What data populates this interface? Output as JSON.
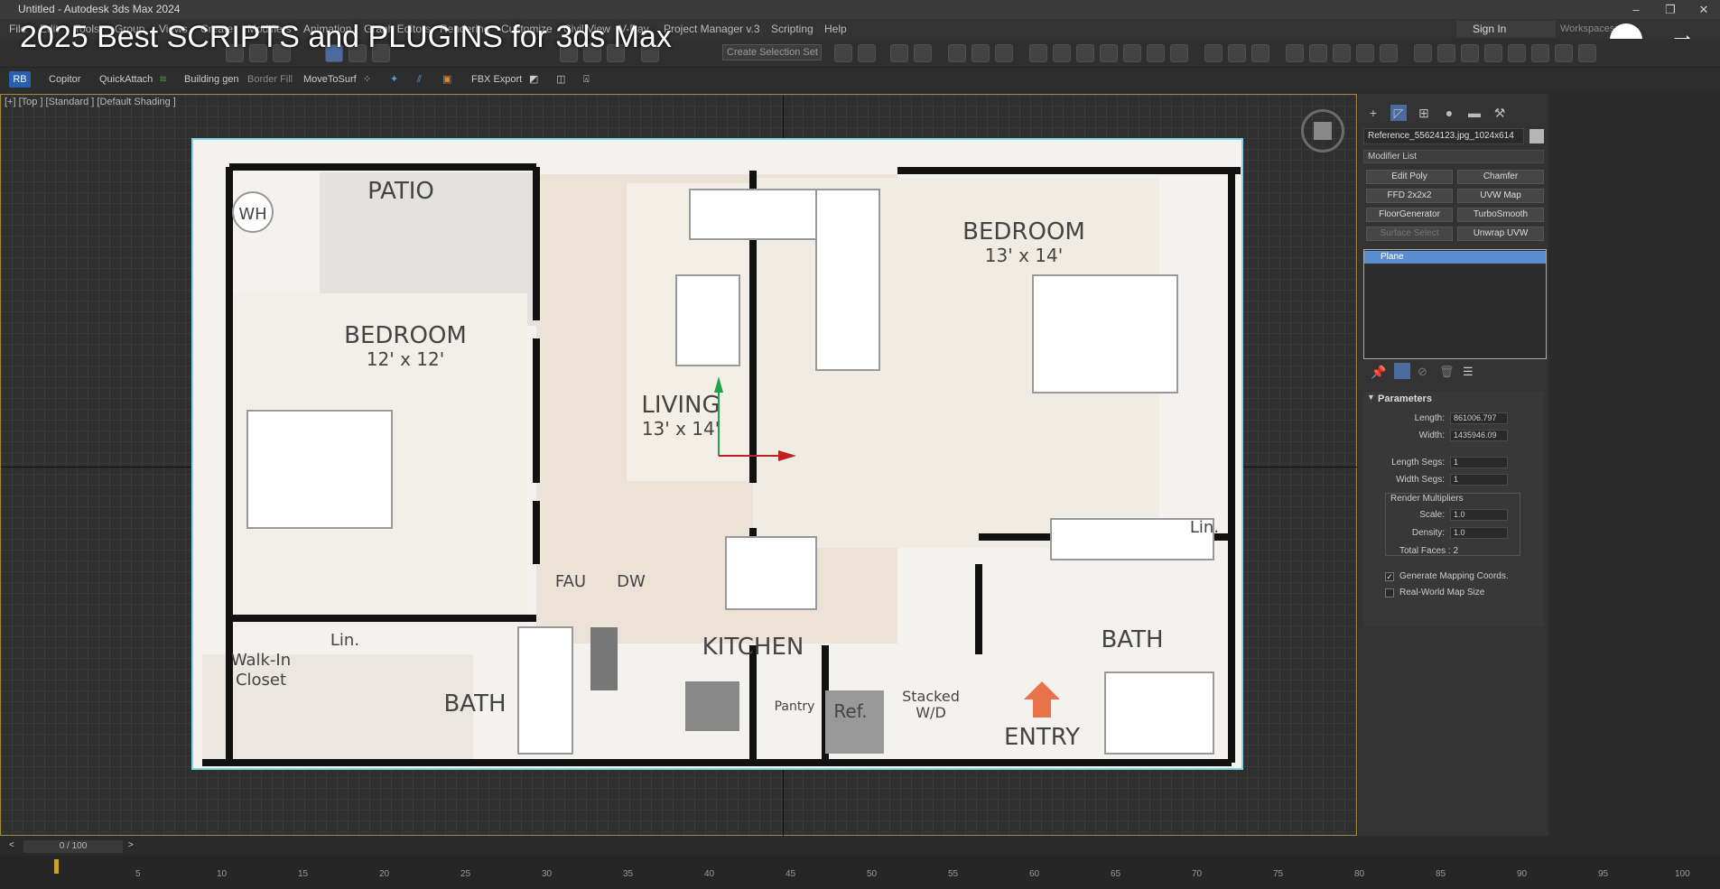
{
  "window": {
    "title": "Untitled - Autodesk 3ds Max 2024"
  },
  "overlay": {
    "title": "2025 Best SCRIPTS and PLUGINS for 3ds Max"
  },
  "menubar": {
    "items": [
      "File",
      "Edit",
      "Tools",
      "Group",
      "Views",
      "Create",
      "Modifiers",
      "Animation",
      "Graph Editors",
      "Rendering",
      "Customize",
      "Civil View",
      "V-Ray",
      "Project Manager v.3",
      "Scripting",
      "Help"
    ],
    "sign_in": "Sign In",
    "workspace": "Workspaces:"
  },
  "toolbar": {
    "selection_set_placeholder": "Create Selection Set"
  },
  "ribbon": {
    "logo": "RB",
    "items": [
      "Copitor",
      "QuickAttach",
      "Building gen",
      "Border Fill",
      "MoveToSurf",
      "FBX Export"
    ]
  },
  "viewport": {
    "label": "[+] [Top ] [Standard ] [Default Shading ]"
  },
  "floorplan": {
    "rooms": [
      "PATIO",
      "WH",
      "BEDROOM",
      "12' x 12'",
      "LIVING",
      "13' x 14'",
      "BEDROOM",
      "13' x 14'",
      "Lin.",
      "FAU",
      "DW",
      "KITCHEN",
      "Lin.",
      "Walk-In",
      "Closet",
      "BATH",
      "Pantry",
      "Ref.",
      "Stacked",
      "W/D",
      "ENTRY",
      "BATH"
    ]
  },
  "command_panel": {
    "object_name": "Reference_55624123.jpg_1024x614",
    "modifier_list": "Modifier List",
    "modifier_buttons": [
      "Edit Poly",
      "Chamfer",
      "FFD 2x2x2",
      "UVW Map",
      "FloorGenerator",
      "TurboSmooth",
      "Surface Select",
      "Unwrap UVW"
    ],
    "stack_item": "Plane",
    "parameters": {
      "title": "Parameters",
      "length_label": "Length:",
      "length": "861006.797",
      "width_label": "Width:",
      "width": "1435946.09",
      "length_segs_label": "Length Segs:",
      "length_segs": "1",
      "width_segs_label": "Width Segs:",
      "width_segs": "1",
      "render_mult": "Render Multipliers",
      "scale_label": "Scale:",
      "scale": "1.0",
      "density_label": "Density:",
      "density": "1.0",
      "total_faces": "Total Faces : 2",
      "gen_mapping": "Generate Mapping Coords.",
      "real_world": "Real-World Map Size"
    }
  },
  "timeline": {
    "frame": "0 / 100",
    "ticks": [
      "5",
      "10",
      "15",
      "20",
      "25",
      "30",
      "35",
      "40",
      "45",
      "50",
      "55",
      "60",
      "65",
      "70",
      "75",
      "80",
      "85",
      "90",
      "95",
      "100"
    ]
  },
  "colors": {
    "accent": "#5a8ed0",
    "viewport_border": "#a08a3a",
    "plane_outline": "#7fd6e8",
    "entry_arrow": "#e8734a"
  }
}
